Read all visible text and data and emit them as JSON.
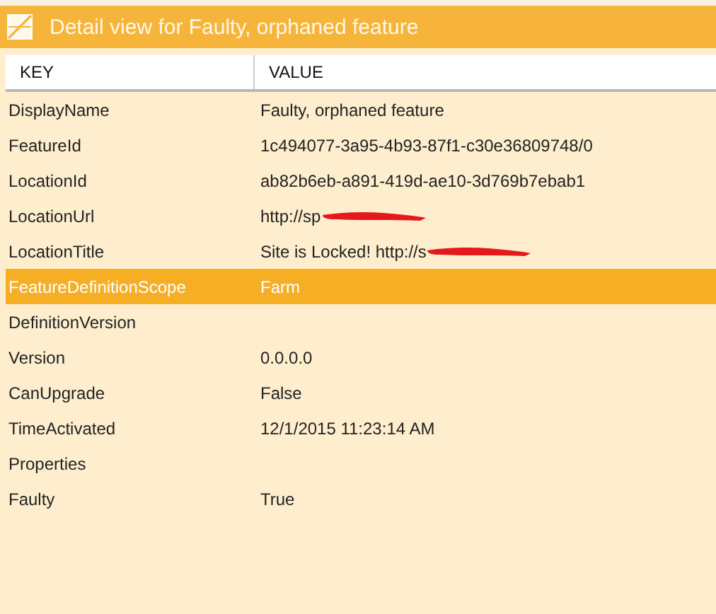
{
  "window": {
    "title": "Detail view for Faulty, orphaned feature"
  },
  "table": {
    "columns": [
      "KEY",
      "VALUE"
    ],
    "rows": [
      {
        "key": "DisplayName",
        "value": "Faulty, orphaned feature",
        "selected": false,
        "redacted": false
      },
      {
        "key": "FeatureId",
        "value": "1c494077-3a95-4b93-87f1-c30e36809748/0",
        "selected": false,
        "redacted": false
      },
      {
        "key": "LocationId",
        "value": "ab82b6eb-a891-419d-ae10-3d769b7ebab1",
        "selected": false,
        "redacted": false
      },
      {
        "key": "LocationUrl",
        "value": "http://sp",
        "selected": false,
        "redacted": true
      },
      {
        "key": "LocationTitle",
        "value": "Site is Locked! http://s",
        "selected": false,
        "redacted": true
      },
      {
        "key": "FeatureDefinitionScope",
        "value": "Farm",
        "selected": true,
        "redacted": false
      },
      {
        "key": "DefinitionVersion",
        "selected": false,
        "redacted": false
      },
      {
        "key": "Version",
        "value": "0.0.0.0",
        "selected": false,
        "redacted": false
      },
      {
        "key": "CanUpgrade",
        "value": "False",
        "selected": false,
        "redacted": false
      },
      {
        "key": "TimeActivated",
        "value": "12/1/2015 11:23:14 AM",
        "selected": false,
        "redacted": false
      },
      {
        "key": "Properties",
        "selected": false,
        "redacted": false
      },
      {
        "key": "Faulty",
        "value": "True",
        "selected": false,
        "redacted": false
      }
    ]
  }
}
